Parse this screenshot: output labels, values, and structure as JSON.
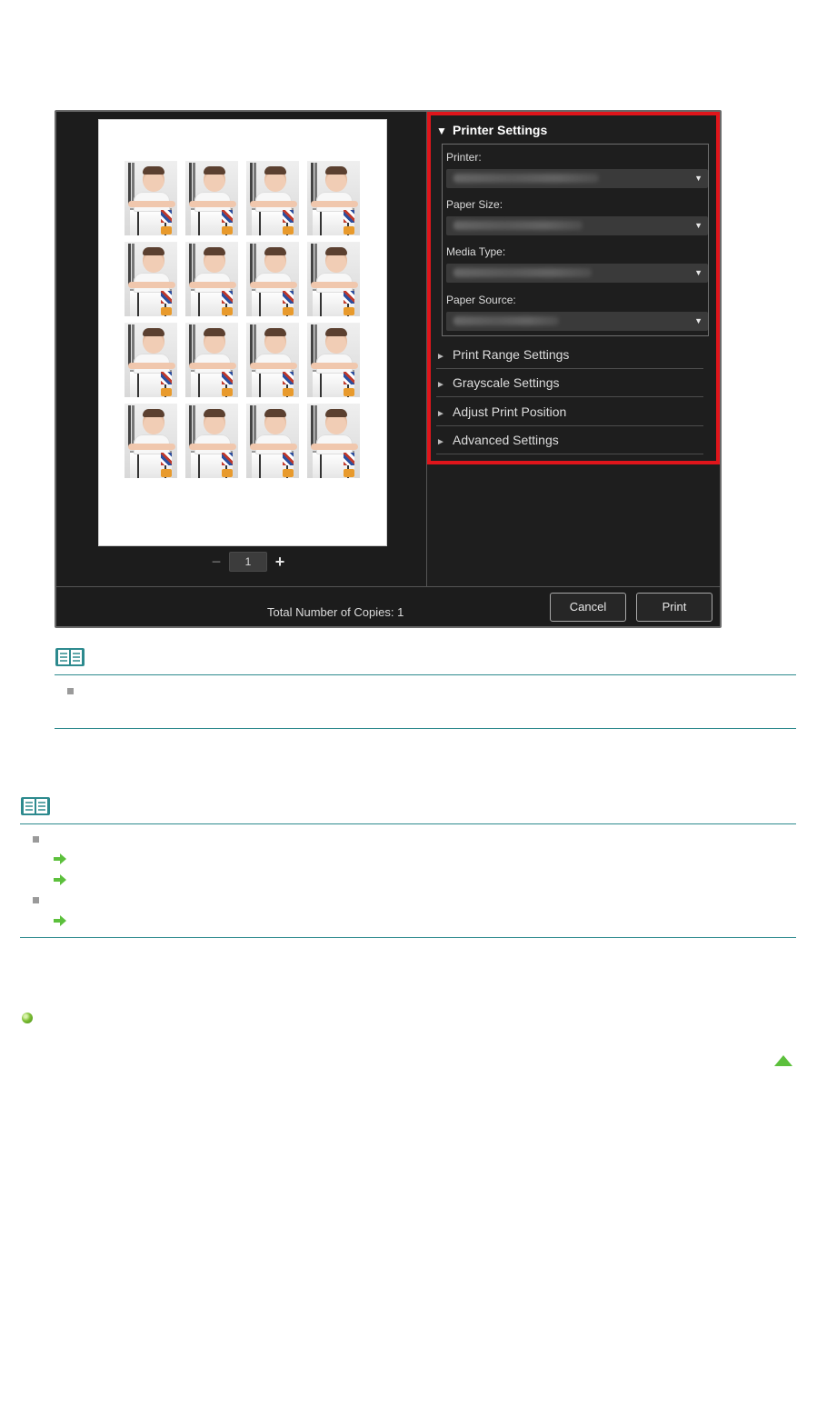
{
  "preview": {
    "page_number": "1",
    "minus_icon": "minus-icon",
    "plus_icon": "plus-icon",
    "photo_count": 16
  },
  "settings": {
    "printer_settings": {
      "label": "Printer Settings",
      "expanded": true
    },
    "fields": {
      "printer": {
        "label": "Printer:"
      },
      "paper_size": {
        "label": "Paper Size:"
      },
      "media_type": {
        "label": "Media Type:"
      },
      "paper_source": {
        "label": "Paper Source:"
      }
    },
    "collapsed_sections": [
      {
        "label": "Print Range Settings"
      },
      {
        "label": "Grayscale Settings"
      },
      {
        "label": "Adjust Print Position"
      },
      {
        "label": "Advanced Settings"
      }
    ],
    "highlight_color": "#e0151b"
  },
  "footer": {
    "total_copies_label": "Total Number of Copies:  1",
    "cancel_label": "Cancel",
    "print_label": "Print"
  },
  "colors": {
    "note_rule": "#2d8a8e",
    "link_arrow": "#5cc03c"
  }
}
